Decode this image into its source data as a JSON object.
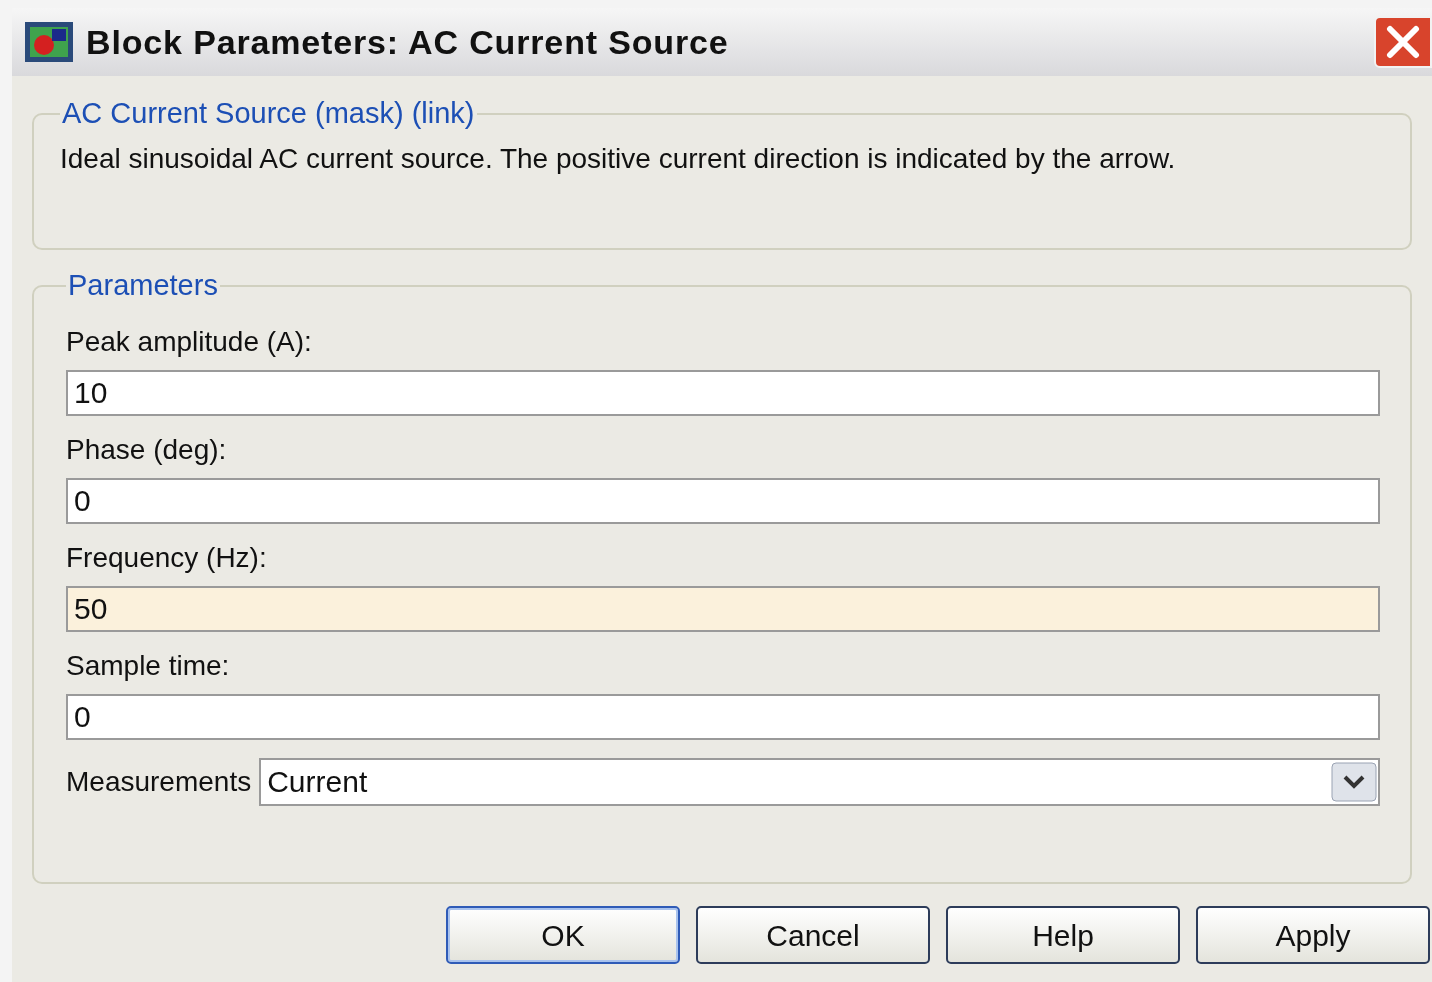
{
  "window": {
    "title": "Block Parameters: AC Current Source"
  },
  "description_group": {
    "title": "AC Current Source (mask) (link)",
    "text": "Ideal sinusoidal AC current source. The positive current direction is indicated by the arrow."
  },
  "parameters_group": {
    "title": "Parameters",
    "fields": [
      {
        "label": "Peak amplitude (A):",
        "value": "10",
        "highlighted": false
      },
      {
        "label": "Phase (deg):",
        "value": "0",
        "highlighted": false
      },
      {
        "label": "Frequency (Hz):",
        "value": "50",
        "highlighted": true
      },
      {
        "label": "Sample time:",
        "value": "0",
        "highlighted": false
      }
    ],
    "measurements": {
      "label": "Measurements",
      "value": "Current"
    }
  },
  "buttons": [
    {
      "label": "OK",
      "default": true
    },
    {
      "label": "Cancel",
      "default": false
    },
    {
      "label": "Help",
      "default": false
    },
    {
      "label": "Apply",
      "default": false
    }
  ]
}
